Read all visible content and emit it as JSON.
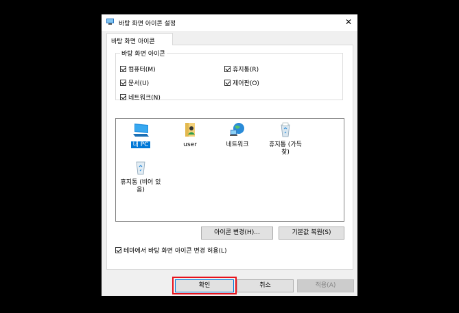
{
  "window": {
    "title": "바탕 화면 아이콘 설정",
    "tab_label": "바탕 화면 아이콘"
  },
  "group": {
    "legend": "바탕 화면 아이콘",
    "checkboxes": [
      {
        "label": "컴퓨터(M)",
        "checked": true
      },
      {
        "label": "휴지통(R)",
        "checked": true
      },
      {
        "label": "문서(U)",
        "checked": true
      },
      {
        "label": "제어판(O)",
        "checked": true
      },
      {
        "label": "네트워크(N)",
        "checked": true
      }
    ]
  },
  "icons": [
    {
      "label": "내 PC",
      "icon": "monitor-icon",
      "selected": true
    },
    {
      "label": "user",
      "icon": "user-folder-icon"
    },
    {
      "label": "네트워크",
      "icon": "network-globe-icon"
    },
    {
      "label": "휴지통 (가득 찾)",
      "icon": "recycle-bin-full-icon"
    },
    {
      "label": "휴지통 (비어 있음)",
      "icon": "recycle-bin-empty-icon"
    }
  ],
  "buttons": {
    "change_icon": "아이콘 변경(H)...",
    "restore_default": "기본값 복원(S)",
    "ok": "확인",
    "cancel": "취소",
    "apply": "적용(A)"
  },
  "theme_checkbox": {
    "label": "테마에서 바탕 화면 아이콘 변경 허용(L)",
    "checked": true
  },
  "colors": {
    "selection": "#0078d7",
    "highlight": "#e8121c"
  }
}
